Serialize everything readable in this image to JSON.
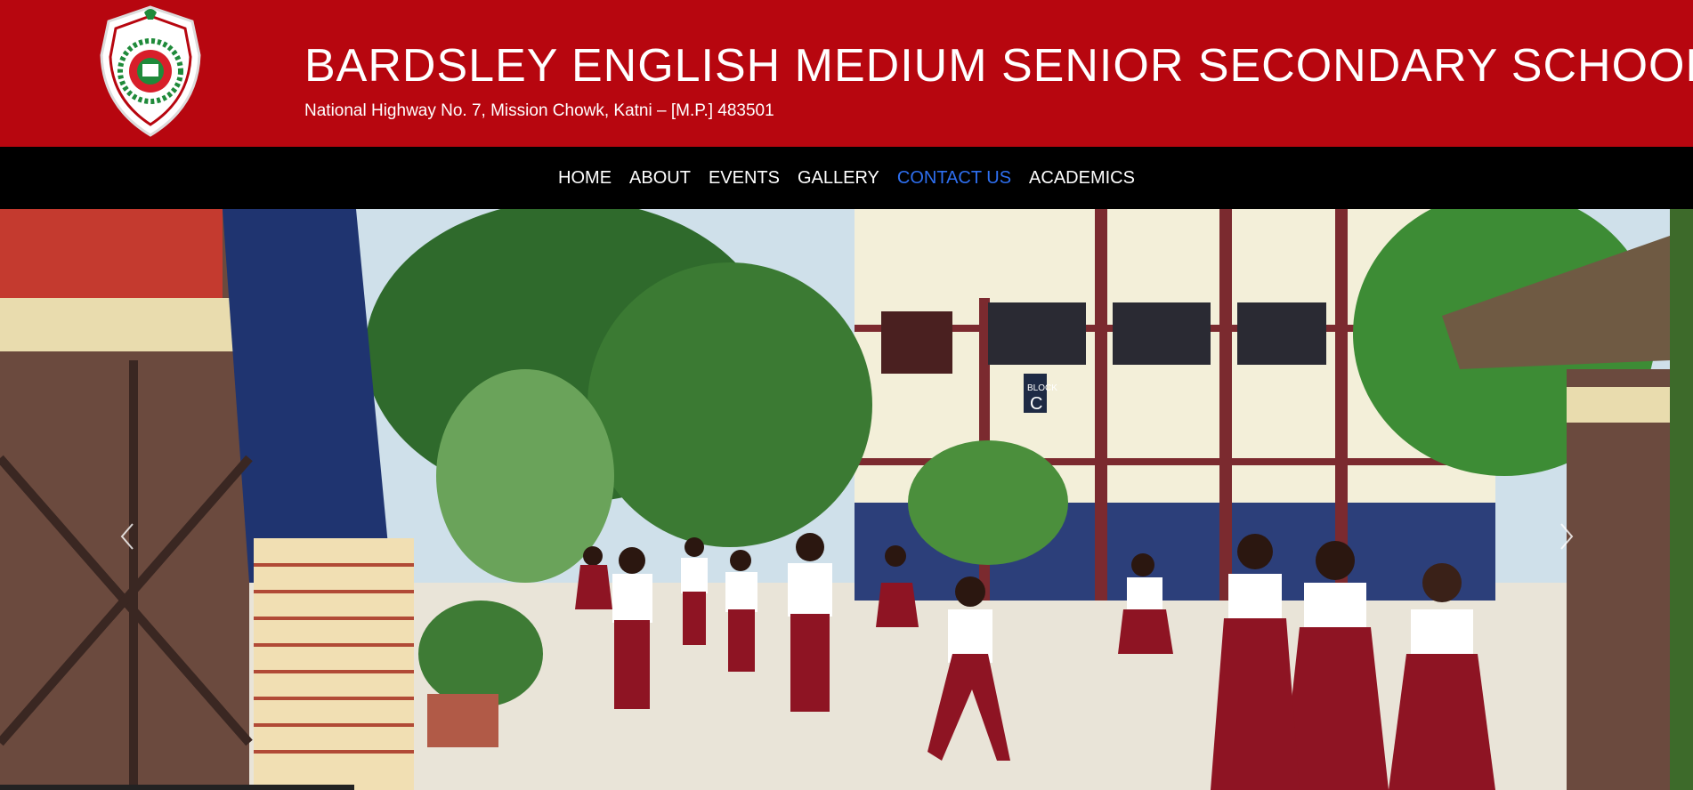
{
  "header": {
    "school_name": "BARDSLEY ENGLISH MEDIUM SENIOR SECONDARY SCHOOL",
    "address": "National Highway No. 7, Mission Chowk, Katni – [M.P.] 483501",
    "background_color": "#b7060f"
  },
  "nav": {
    "items": [
      {
        "label": "HOME"
      },
      {
        "label": "ABOUT"
      },
      {
        "label": "EVENTS"
      },
      {
        "label": "GALLERY"
      },
      {
        "label": "CONTACT US"
      },
      {
        "label": "ACADEMICS"
      }
    ],
    "active_color": "#2e6ff0"
  },
  "hero": {
    "building_sign": "BLOCK C",
    "prev_icon": "chevron-left-icon",
    "next_icon": "chevron-right-icon"
  }
}
